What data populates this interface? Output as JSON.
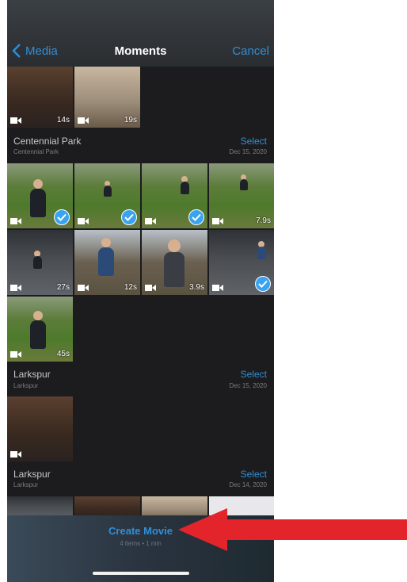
{
  "nav": {
    "back_label": "Media",
    "title": "Moments",
    "cancel_label": "Cancel"
  },
  "sections": [
    {
      "title": "Centennial Park",
      "subtitle": "Centennial Park",
      "select_label": "Select",
      "date": "Dec 15, 2020"
    },
    {
      "title": "Larkspur",
      "subtitle": "Larkspur",
      "select_label": "Select",
      "date": "Dec 15, 2020"
    },
    {
      "title": "Larkspur",
      "subtitle": "Larkspur",
      "select_label": "Select",
      "date": "Dec 14, 2020"
    }
  ],
  "top_clips": [
    {
      "duration": "14s"
    },
    {
      "duration": "19s"
    }
  ],
  "centennial_clips": [
    {
      "duration": "",
      "selected": true
    },
    {
      "duration": "",
      "selected": true
    },
    {
      "duration": "",
      "selected": true
    },
    {
      "duration": "7.9s",
      "selected": false
    },
    {
      "duration": "27s",
      "selected": false
    },
    {
      "duration": "12s",
      "selected": false
    },
    {
      "duration": "3.9s",
      "selected": false
    },
    {
      "duration": "",
      "selected": true
    },
    {
      "duration": "45s",
      "selected": false
    }
  ],
  "bottom_bar": {
    "create_label": "Create Movie",
    "summary": "4 items • 1 min"
  },
  "colors": {
    "accent": "#2f8fd8",
    "check": "#3aa3f0",
    "arrow": "#e3242b",
    "background": "#1c1c1e"
  },
  "icons": {
    "back": "chevron-left-icon",
    "video": "video-camera-icon",
    "check": "checkmark-icon"
  }
}
